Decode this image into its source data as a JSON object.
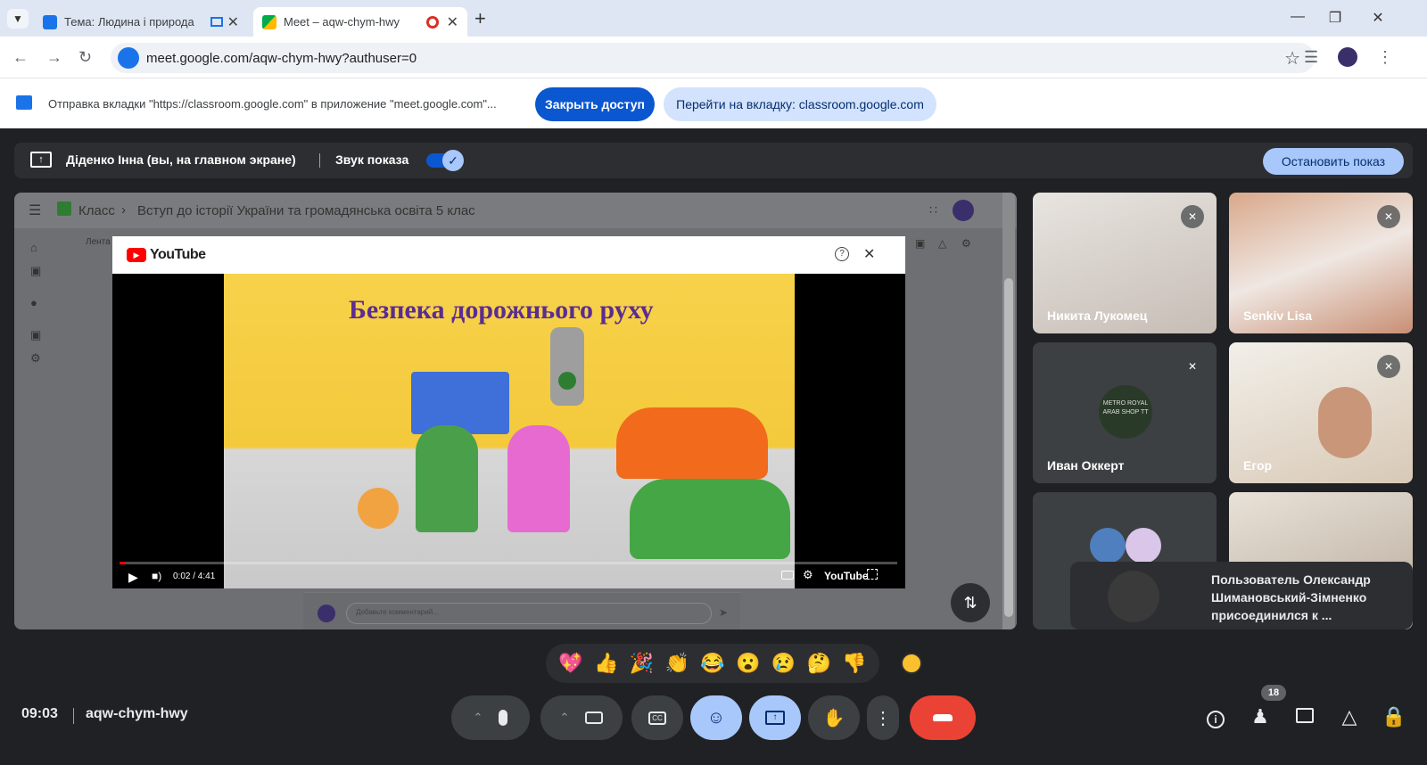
{
  "browser": {
    "tabs": [
      {
        "title": "Тема: Людина і природа",
        "active": false
      },
      {
        "title": "Meet – aqw-chym-hwy",
        "active": true
      }
    ],
    "url": "meet.google.com/aqw-chym-hwy?authuser=0"
  },
  "share_banner": {
    "message": "Отправка вкладки \"https://classroom.google.com\" в приложение \"meet.google.com\"...",
    "stop_button": "Закрыть доступ",
    "switch_button": "Перейти на вкладку: classroom.google.com"
  },
  "presenting_bar": {
    "presenter": "Діденко Інна (вы, на главном экране)",
    "audio_label": "Звук показа",
    "stop_label": "Остановить показ"
  },
  "classroom": {
    "breadcrumb_root": "Класс",
    "breadcrumb_course": "Вступ до історії України та громадянська освіта 5 клас",
    "tab_label": "Лента",
    "comment_placeholder": "Добавьте комментарий..."
  },
  "youtube": {
    "brand": "YouTube",
    "video_title": "Безпека дорожнього руху",
    "time": "0:02 / 4:41",
    "progress": 0.007
  },
  "participants": [
    {
      "name": "Никита Лукомец",
      "muted": true
    },
    {
      "name": "Senkiv Lisa",
      "muted": true
    },
    {
      "name": "Иван Оккерт",
      "muted": true,
      "avatar_text": "METRO ROYAL ARAB SHOP TT"
    },
    {
      "name": "Егор",
      "muted": true
    }
  ],
  "notification": "Пользователь Олександр Шимановський-Зімненко присоединился к ...",
  "reactions": [
    "💖",
    "👍",
    "🎉",
    "👏",
    "😂",
    "😮",
    "😢",
    "🤔",
    "👎"
  ],
  "meeting": {
    "time": "09:03",
    "code": "aqw-chym-hwy",
    "participant_count": "18"
  },
  "colors": {
    "accent_blue": "#1a73e8",
    "light_blue": "#a8c7fa",
    "hangup_red": "#ea4335",
    "meet_bg": "#202124"
  }
}
